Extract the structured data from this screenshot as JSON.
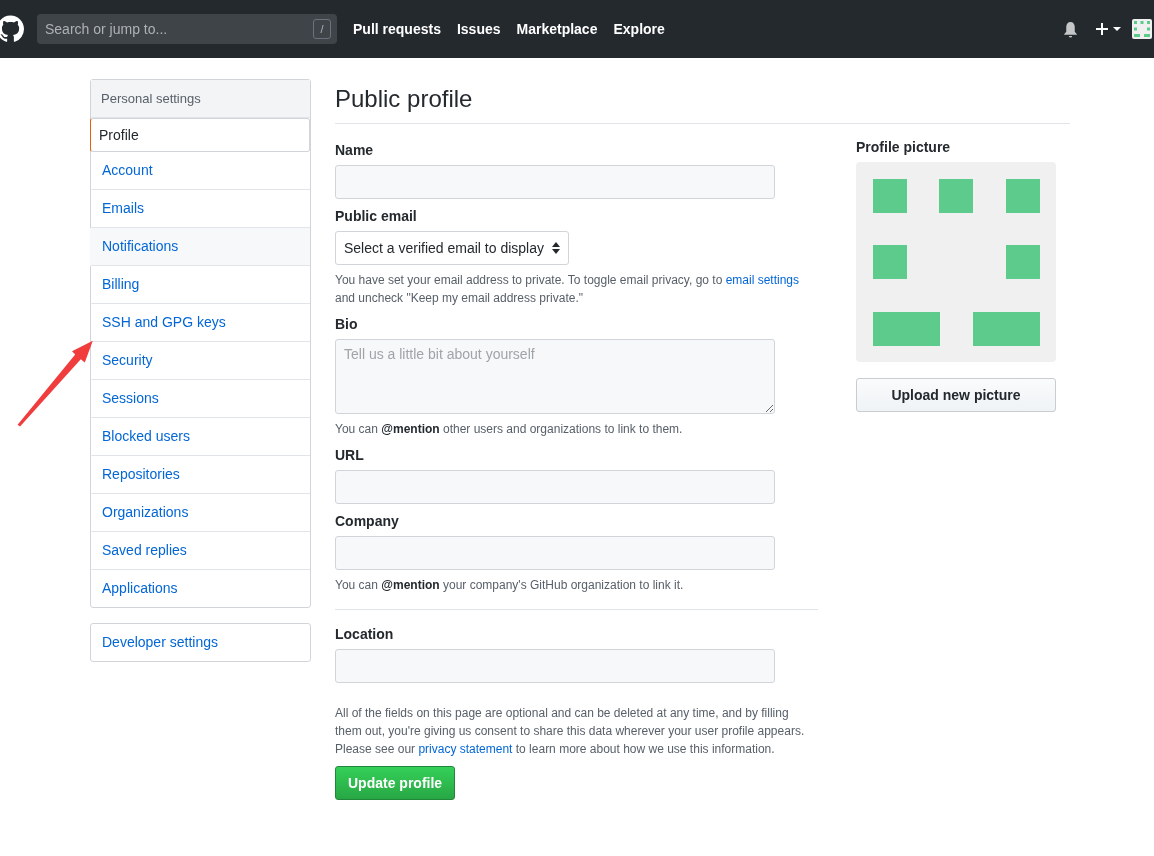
{
  "header": {
    "search": {
      "placeholder": "Search or jump to...",
      "key_hint": "/"
    },
    "nav": [
      "Pull requests",
      "Issues",
      "Marketplace",
      "Explore"
    ]
  },
  "sidebar": {
    "heading": "Personal settings",
    "items": [
      {
        "label": "Profile",
        "selected": true,
        "highlighted": false
      },
      {
        "label": "Account",
        "selected": false,
        "highlighted": false
      },
      {
        "label": "Emails",
        "selected": false,
        "highlighted": false
      },
      {
        "label": "Notifications",
        "selected": false,
        "highlighted": true
      },
      {
        "label": "Billing",
        "selected": false,
        "highlighted": false
      },
      {
        "label": "SSH and GPG keys",
        "selected": false,
        "highlighted": false
      },
      {
        "label": "Security",
        "selected": false,
        "highlighted": false
      },
      {
        "label": "Sessions",
        "selected": false,
        "highlighted": false
      },
      {
        "label": "Blocked users",
        "selected": false,
        "highlighted": false
      },
      {
        "label": "Repositories",
        "selected": false,
        "highlighted": false
      },
      {
        "label": "Organizations",
        "selected": false,
        "highlighted": false
      },
      {
        "label": "Saved replies",
        "selected": false,
        "highlighted": false
      },
      {
        "label": "Applications",
        "selected": false,
        "highlighted": false
      }
    ],
    "developer": "Developer settings"
  },
  "main": {
    "title": "Public profile",
    "fields": [
      {
        "kind": "text",
        "label": "Name",
        "divider_before": false
      },
      {
        "kind": "select",
        "label": "Public email",
        "value": "Select a verified email to display",
        "divider_before": false,
        "note": [
          {
            "text": "You have set your email address to private. To toggle email privacy, go to ",
            "link": false
          },
          {
            "text": "email settings",
            "link": true
          },
          {
            "text": " and uncheck \"Keep my email address private.\"",
            "link": false
          }
        ]
      },
      {
        "kind": "textarea",
        "label": "Bio",
        "placeholder": "Tell us a little bit about yourself",
        "divider_before": false,
        "note": [
          {
            "text": "You can **@mention** other users and organizations to link to them.",
            "link": false
          }
        ]
      },
      {
        "kind": "text",
        "label": "URL",
        "divider_before": false
      },
      {
        "kind": "text",
        "label": "Company",
        "divider_before": false,
        "note": [
          {
            "text": "You can **@mention** your company's GitHub organization to link it.",
            "link": false
          }
        ]
      },
      {
        "kind": "text",
        "label": "Location",
        "divider_before": true
      }
    ],
    "footer_note": [
      {
        "text": "All of the fields on this page are optional and can be deleted at any time, and by filling them out, you're giving us consent to share this data wherever your user profile appears. Please see our ",
        "link": false
      },
      {
        "text": "privacy statement",
        "link": true
      },
      {
        "text": " to learn more about how we use this information.",
        "link": false
      }
    ],
    "submit": "Update profile"
  },
  "picture": {
    "label": "Profile picture",
    "upload": "Upload new picture"
  }
}
